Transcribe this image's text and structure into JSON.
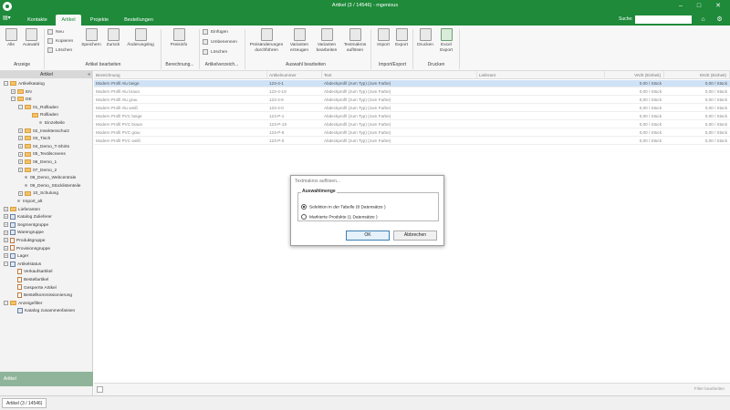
{
  "window": {
    "title": "Artikel (3 / 14546) - mgenious"
  },
  "tabs": [
    {
      "label": "Kontakte",
      "active": false
    },
    {
      "label": "Artikel",
      "active": true
    },
    {
      "label": "Projekte",
      "active": false
    },
    {
      "label": "Bestellungen",
      "active": false
    }
  ],
  "search": {
    "label": "Suche:",
    "value": "",
    "placeholder": ""
  },
  "ribbon": {
    "anzeige": {
      "label": "Anzeige",
      "alle": "Alle",
      "auswahl": "Auswahl"
    },
    "artikel_bearbeiten": {
      "label": "Artikel bearbeiten",
      "neu": "Neu",
      "kopieren": "Kopieren",
      "loeschen": "Löschen",
      "speichern": "Speichern",
      "zurueck": "Zurück",
      "aenderungslog": "Änderungslog"
    },
    "berechnung": {
      "label": "Berechnung...",
      "preisinfo": "Preisinfo"
    },
    "artikelverzeich": {
      "label": "Artikelverzeich...",
      "einfuegen": "Einfügen",
      "umbenennen": "Umbenennen",
      "loeschen": "Löschen"
    },
    "auswahl_bearbeiten": {
      "label": "Auswahl bearbeiten",
      "preisaenderungen_1": "Preisänderungen",
      "preisaenderungen_2": "durchführen",
      "varianten_erzeugen_1": "Varianten",
      "varianten_erzeugen_2": "erzeugen",
      "varianten_bearbeiten_1": "Varianten",
      "varianten_bearbeiten_2": "bearbeiten",
      "textmakros_1": "Textmakros",
      "textmakros_2": "auflösen"
    },
    "import_export": {
      "label": "Import/Export",
      "import": "Import",
      "export": "Export"
    },
    "drucken": {
      "label": "Drucken",
      "drucken": "Drucken",
      "excel_1": "Excel",
      "excel_2": "Export"
    }
  },
  "sidebar": {
    "header": "Artikel",
    "footer": "Artikel",
    "tree": [
      {
        "label": "Artikelkatalog",
        "icon": "folder-icon",
        "exp": "−",
        "indent": 0
      },
      {
        "label": "EN",
        "icon": "folder-icon",
        "exp": "+",
        "indent": 1
      },
      {
        "label": "DE",
        "icon": "folder-icon",
        "exp": "−",
        "indent": 1
      },
      {
        "label": "01_Rollladen",
        "icon": "folder-icon",
        "exp": "−",
        "indent": 2
      },
      {
        "label": "Rollladen",
        "icon": "folder-icon",
        "exp": "",
        "indent": 3
      },
      {
        "label": "Einzelteile",
        "icon": "dot-icon",
        "exp": "",
        "indent": 4
      },
      {
        "label": "02_Insektenschutz",
        "icon": "folder-icon",
        "exp": "+",
        "indent": 2
      },
      {
        "label": "03_Tisch",
        "icon": "folder-icon",
        "exp": "+",
        "indent": 2
      },
      {
        "label": "04_Demo_T-Shirts",
        "icon": "folder-icon",
        "exp": "+",
        "indent": 2
      },
      {
        "label": "05_Textilscreens",
        "icon": "folder-icon",
        "exp": "+",
        "indent": 2
      },
      {
        "label": "06_Demo_1",
        "icon": "folder-icon",
        "exp": "+",
        "indent": 2
      },
      {
        "label": "07_Demo_2",
        "icon": "folder-icon",
        "exp": "+",
        "indent": 2
      },
      {
        "label": "08_Demo_Webcentrale",
        "icon": "dot-icon",
        "exp": "",
        "indent": 2
      },
      {
        "label": "09_Demo_Stücklistenteile",
        "icon": "dot-icon",
        "exp": "",
        "indent": 2
      },
      {
        "label": "10_Schulung",
        "icon": "folder-icon",
        "exp": "+",
        "indent": 2
      },
      {
        "label": "Import_alt",
        "icon": "dot-icon",
        "exp": "",
        "indent": 1
      },
      {
        "label": "Lieferanten",
        "icon": "folder-icon",
        "exp": "+",
        "indent": 0
      },
      {
        "label": "Katalog Zulieferer",
        "icon": "box-icon",
        "exp": "+",
        "indent": 0
      },
      {
        "label": "Segmentgruppe",
        "icon": "box-icon",
        "exp": "+",
        "indent": 0
      },
      {
        "label": "Warengruppe",
        "icon": "box-icon",
        "exp": "+",
        "indent": 0
      },
      {
        "label": "Produktgruppe",
        "icon": "doc-icon",
        "exp": "+",
        "indent": 0
      },
      {
        "label": "Provisionsgruppe",
        "icon": "doc-icon",
        "exp": "+",
        "indent": 0
      },
      {
        "label": "Lager",
        "icon": "box-icon",
        "exp": "+",
        "indent": 0
      },
      {
        "label": "Artikelstatus",
        "icon": "box-icon",
        "exp": "−",
        "indent": 0
      },
      {
        "label": "Verkaufsartikel",
        "icon": "doc-icon",
        "exp": "",
        "indent": 1
      },
      {
        "label": "Bestellartikel",
        "icon": "doc-icon",
        "exp": "",
        "indent": 1
      },
      {
        "label": "Gesperrte Artikel",
        "icon": "doc-icon",
        "exp": "",
        "indent": 1
      },
      {
        "label": "Bestellkommissionierung",
        "icon": "doc-icon",
        "exp": "",
        "indent": 1
      },
      {
        "label": "Anzeigefilter",
        "icon": "folder-icon",
        "exp": "−",
        "indent": 0
      },
      {
        "label": "Katalog zusammenfassen",
        "icon": "checkbox-icon",
        "exp": "",
        "indent": 1
      }
    ]
  },
  "grid": {
    "columns": [
      "Bezeichnung",
      "Artikelnummer",
      "Text",
      "Lieferant",
      "VK/E (Einheit)",
      "EK/E (Einheit)"
    ],
    "rows": [
      {
        "name": "Modern Profil Alu beige",
        "nr": "123-4-1",
        "text": "Abdeckprofil (zum Typ) (zum Farbe)",
        "vk": "0,00 / Stück",
        "ek": "0,00 / Stück",
        "selected": true
      },
      {
        "name": "Modern Profil Alu braun",
        "nr": "123-4-1S",
        "text": "Abdeckprofil (zum Typ) (zum Farbe)",
        "vk": "0,00 / Stück",
        "ek": "0,00 / Stück",
        "selected": false
      },
      {
        "name": "Modern Profil Alu grau",
        "nr": "123-4-6",
        "text": "Abdeckprofil (zum Typ) (zum Farbe)",
        "vk": "0,00 / Stück",
        "ek": "0,00 / Stück",
        "selected": false
      },
      {
        "name": "Modern Profil Alu weiß",
        "nr": "123-4-0",
        "text": "Abdeckprofil (zum Typ) (zum Farbe)",
        "vk": "0,00 / Stück",
        "ek": "0,00 / Stück",
        "selected": false
      },
      {
        "name": "Modern Profil PVC beige",
        "nr": "123-P-1",
        "text": "Abdeckprofil (zum Typ) (zum Farbe)",
        "vk": "0,00 / Stück",
        "ek": "0,00 / Stück",
        "selected": false
      },
      {
        "name": "Modern Profil PVC braun",
        "nr": "123-P-1S",
        "text": "Abdeckprofil (zum Typ) (zum Farbe)",
        "vk": "0,00 / Stück",
        "ek": "0,00 / Stück",
        "selected": false
      },
      {
        "name": "Modern Profil PVC grau",
        "nr": "123-P-6",
        "text": "Abdeckprofil (zum Typ) (zum Farbe)",
        "vk": "0,00 / Stück",
        "ek": "0,00 / Stück",
        "selected": false
      },
      {
        "name": "Modern Profil PVC weiß",
        "nr": "123-P-0",
        "text": "Abdeckprofil (zum Typ) (zum Farbe)",
        "vk": "0,00 / Stück",
        "ek": "0,00 / Stück",
        "selected": false
      }
    ],
    "footer_label": "Filter bearbeiten"
  },
  "dialog": {
    "title": "Textmakros auflösen...",
    "group_label": "Auswahlmenge",
    "option_selection": "Selektion in der Tabelle (8 Datensätze )",
    "option_marked": "Markierte Produkte (1 Datensätze )",
    "ok": "OK",
    "cancel": "Abbrechen"
  },
  "statusbar": {
    "tab_label": "Artikel (3 / 14546)"
  },
  "colors": {
    "accent": "#1e8a3a",
    "selection": "#cfe2f6",
    "sidebar_footer": "#8fb49a"
  }
}
